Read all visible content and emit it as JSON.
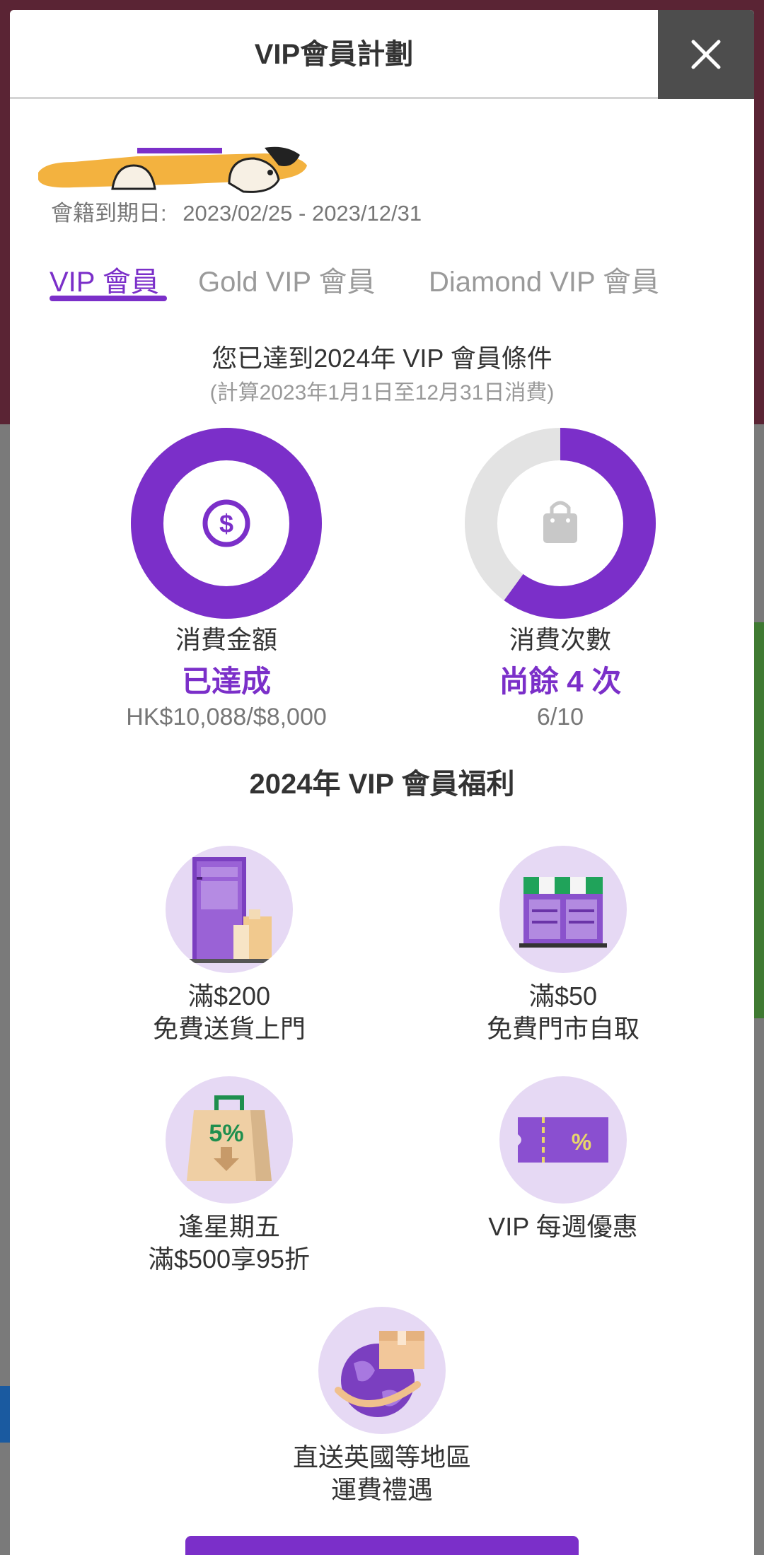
{
  "modal": {
    "title": "VIP會員計劃"
  },
  "membership": {
    "expiry_label": "會籍到期日:",
    "expiry_range": "2023/02/25 - 2023/12/31"
  },
  "tabs": [
    {
      "label": "VIP 會員",
      "active": true
    },
    {
      "label": "Gold VIP 會員",
      "active": false
    },
    {
      "label": "Diamond VIP 會員",
      "active": false
    }
  ],
  "status": {
    "title": "您已達到2024年 VIP 會員條件",
    "subtitle": "(計算2023年1月1日至12月31日消費)"
  },
  "progress": [
    {
      "label": "消費金額",
      "status": "已達成",
      "value": "HK$10,088/$8,000",
      "fraction": 1.0,
      "icon": "dollar-icon"
    },
    {
      "label": "消費次數",
      "status": "尚餘 4 次",
      "value": "6/10",
      "fraction": 0.6,
      "icon": "shopping-bag-icon"
    }
  ],
  "benefits": {
    "title": "2024年 VIP 會員福利",
    "items": [
      {
        "line1": "滿$200",
        "line2": "免費送貨上門",
        "icon": "home-delivery-icon"
      },
      {
        "line1": "滿$50",
        "line2": "免費門市自取",
        "icon": "store-pickup-icon"
      },
      {
        "line1": "逢星期五",
        "line2": "滿$500享95折",
        "icon": "discount-bag-icon",
        "badge": "5%"
      },
      {
        "line1": "VIP 每週優惠",
        "line2": "",
        "icon": "coupon-icon",
        "badge": "%"
      },
      {
        "line1": "直送英國等地區",
        "line2": "運費禮遇",
        "icon": "global-shipping-icon"
      }
    ]
  },
  "colors": {
    "accent": "#7b2fc9",
    "ring_track": "#e3e3e3",
    "benefit_circle": "#e6d9f4"
  }
}
